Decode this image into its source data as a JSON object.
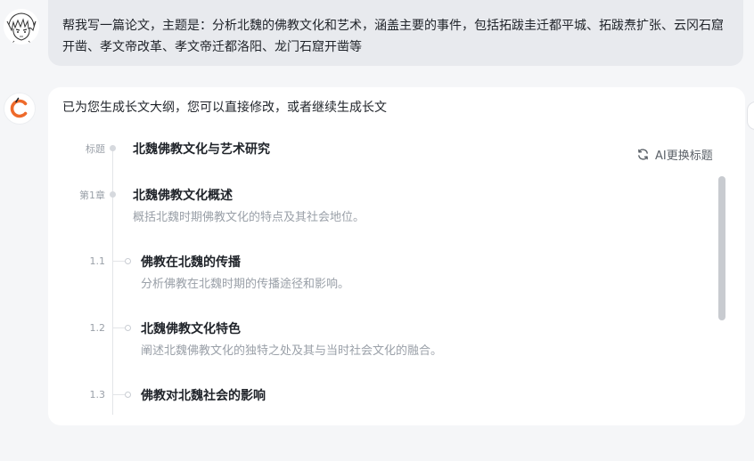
{
  "user_message": {
    "text": "帮我写一篇论文，主题是：分析北魏的佛教文化和艺术，涵盖主要的事件，包括拓跋圭迁都平城、拓跋焘扩张、云冈石窟开凿、孝文帝改革、孝文帝迁都洛阳、龙门石窟开凿等"
  },
  "assistant_message": {
    "intro": "已为您生成长文大纲，您可以直接修改，或者继续生成长文"
  },
  "outline": {
    "title_label": "标题",
    "title": "北魏佛教文化与艺术研究",
    "ai_button_label": "AI更换标题",
    "chapter": {
      "label": "第1章",
      "title": "北魏佛教文化概述",
      "desc": "概括北魏时期佛教文化的特点及其社会地位。"
    },
    "sections": [
      {
        "num": "1.1",
        "title": "佛教在北魏的传播",
        "desc": "分析佛教在北魏时期的传播途径和影响。"
      },
      {
        "num": "1.2",
        "title": "北魏佛教文化特色",
        "desc": "阐述北魏佛教文化的独特之处及其与当时社会文化的融合。"
      },
      {
        "num": "1.3",
        "title": "佛教对北魏社会的影响",
        "desc": ""
      }
    ]
  },
  "icons": {
    "user_avatar": "manga-character-avatar",
    "bot_avatar": "orange-c-logo",
    "refresh": "refresh-icon"
  },
  "colors": {
    "page_bg": "#f5f6f8",
    "user_bubble": "#e8eaee",
    "card_bg": "#ffffff",
    "brand_orange": "#ee6a2b",
    "muted_text": "#9aa0a8"
  }
}
